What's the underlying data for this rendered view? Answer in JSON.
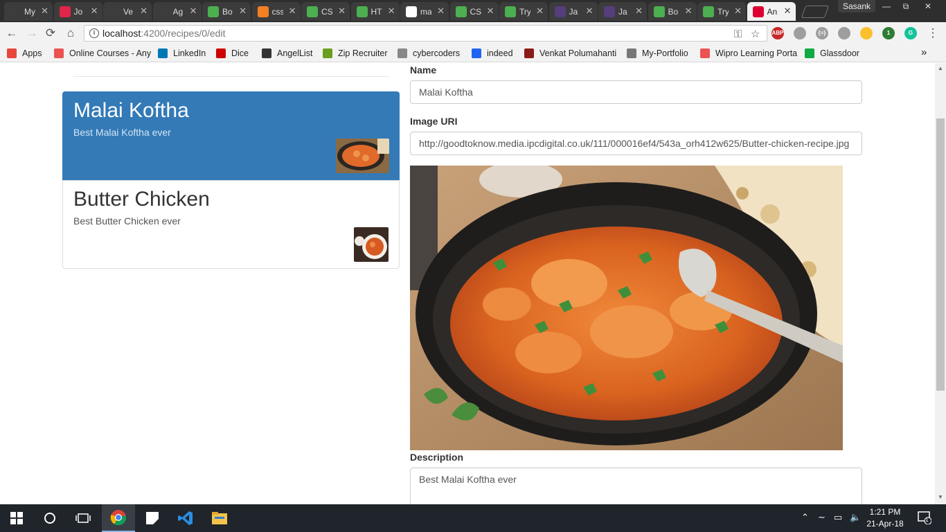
{
  "browser": {
    "tabs": [
      {
        "title": "My",
        "icon": "page-icon",
        "color": "#3c3c3c"
      },
      {
        "title": "Jo",
        "icon": "opera-icon",
        "color": "#e0244a"
      },
      {
        "title": "Ve",
        "icon": "page-icon",
        "color": "#3c3c3c"
      },
      {
        "title": "Ag",
        "icon": "page-icon",
        "color": "#3c3c3c"
      },
      {
        "title": "Bo",
        "icon": "w3schools-icon",
        "color": "#4caf50"
      },
      {
        "title": "css",
        "icon": "stackoverflow-icon",
        "color": "#f48024"
      },
      {
        "title": "CS",
        "icon": "w3schools-icon",
        "color": "#4caf50"
      },
      {
        "title": "HT",
        "icon": "w3schools-icon",
        "color": "#4caf50"
      },
      {
        "title": "ma",
        "icon": "google-icon",
        "color": "#ffffff"
      },
      {
        "title": "CS",
        "icon": "w3schools-icon",
        "color": "#4caf50"
      },
      {
        "title": "Try",
        "icon": "w3schools-icon",
        "color": "#4caf50"
      },
      {
        "title": "Ja",
        "icon": "bootstrap-icon",
        "color": "#563d7c"
      },
      {
        "title": "Ja",
        "icon": "bootstrap-icon",
        "color": "#563d7c"
      },
      {
        "title": "Bo",
        "icon": "w3schools-icon",
        "color": "#4caf50"
      },
      {
        "title": "Try",
        "icon": "w3schools-icon",
        "color": "#4caf50"
      },
      {
        "title": "An",
        "icon": "angular-icon",
        "color": "#dd0031"
      }
    ],
    "active_tab_index": 15,
    "profile_name": "Sasank",
    "url_host": "localhost",
    "url_path": ":4200/recipes/0/edit",
    "extensions": [
      {
        "label": "ABP",
        "color": "#c62828"
      },
      {
        "label": "",
        "color": "#9e9e9e"
      },
      {
        "label": "{≡}",
        "color": "#9e9e9e"
      },
      {
        "label": "",
        "color": "#9e9e9e"
      },
      {
        "label": "",
        "color": "#fbc02d"
      },
      {
        "label": "1",
        "color": "#2e7d32"
      },
      {
        "label": "G",
        "color": "#15c39a"
      }
    ]
  },
  "bookmarks": [
    {
      "label": "Apps",
      "icon": "apps-grid-icon",
      "color": "#e8453c"
    },
    {
      "label": "Online Courses - Any",
      "icon": "udemy-icon",
      "color": "#ec5252"
    },
    {
      "label": "LinkedIn",
      "icon": "linkedin-icon",
      "color": "#0077b5"
    },
    {
      "label": "Dice",
      "icon": "dice-icon",
      "color": "#cc0000"
    },
    {
      "label": "AngelList",
      "icon": "angellist-icon",
      "color": "#333333"
    },
    {
      "label": "Zip Recruiter",
      "icon": "ziprecruiter-icon",
      "color": "#6a9e1f"
    },
    {
      "label": "cybercoders",
      "icon": "cybercoders-icon",
      "color": "#888888"
    },
    {
      "label": "indeed",
      "icon": "indeed-icon",
      "color": "#2164f3"
    },
    {
      "label": "Venkat Polumahanti",
      "icon": "portfolio-logo-icon",
      "color": "#8b1a1a"
    },
    {
      "label": "My-Portfolio",
      "icon": "page-icon",
      "color": "#777777"
    },
    {
      "label": "Wipro Learning Porta",
      "icon": "udemy-icon",
      "color": "#ec5252"
    },
    {
      "label": "Glassdoor",
      "icon": "glassdoor-icon",
      "color": "#0caa41"
    }
  ],
  "recipes": [
    {
      "name": "Malai Koftha",
      "description": "Best Malai Koftha ever",
      "active": true
    },
    {
      "name": "Butter Chicken",
      "description": "Best Butter Chicken ever",
      "active": false
    }
  ],
  "form": {
    "name_label": "Name",
    "name_value": "Malai Koftha",
    "image_label": "Image URI",
    "image_value": "http://goodtoknow.media.ipcdigital.co.uk/111/000016ef4/543a_orh412w625/Butter-chicken-recipe.jpg",
    "description_label": "Description",
    "description_value": "Best Malai Koftha ever"
  },
  "taskbar": {
    "apps": [
      "start-icon",
      "cortana-icon",
      "task-view-icon",
      "chrome-icon",
      "sticky-notes-icon",
      "vscode-icon",
      "file-explorer-icon"
    ],
    "active_app": "chrome-icon",
    "time": "1:21 PM",
    "date": "21-Apr-18",
    "notification_count": "1"
  },
  "colors": {
    "active_item": "#337ab7",
    "taskbar": "#20242b"
  }
}
